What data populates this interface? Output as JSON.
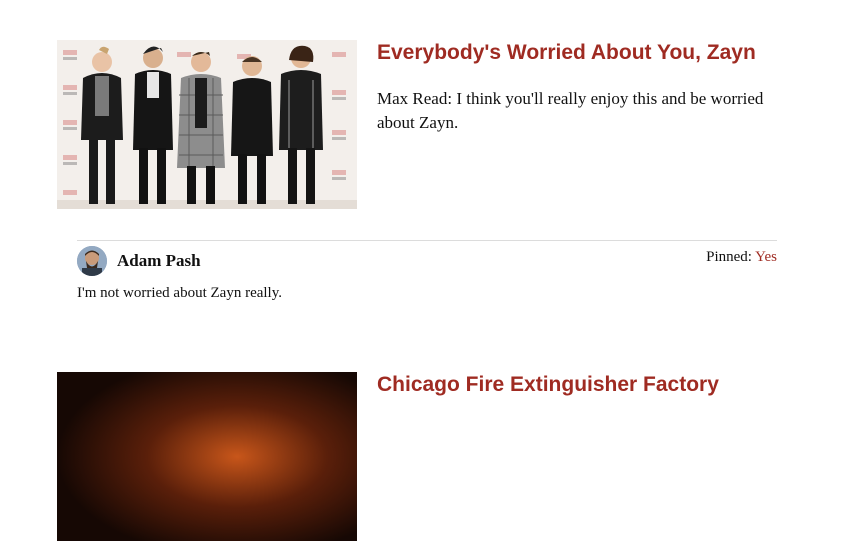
{
  "articles": [
    {
      "title": "Everybody's Worried About You, Zayn",
      "excerpt": "Max Read: I think you'll really enjoy this and be worried about Zayn.",
      "thumbnail": "band-photo"
    },
    {
      "title": "Chicago Fire Extinguisher Factory",
      "thumbnail": "fire-photo"
    }
  ],
  "comment": {
    "author": "Adam Pash",
    "avatar": "user-avatar",
    "body": "I'm not worried about Zayn really.",
    "pinned_label": "Pinned:",
    "pinned_value": "Yes"
  },
  "colors": {
    "accent": "#9f2b22",
    "divider": "#dcdcdc",
    "text": "#111111"
  }
}
